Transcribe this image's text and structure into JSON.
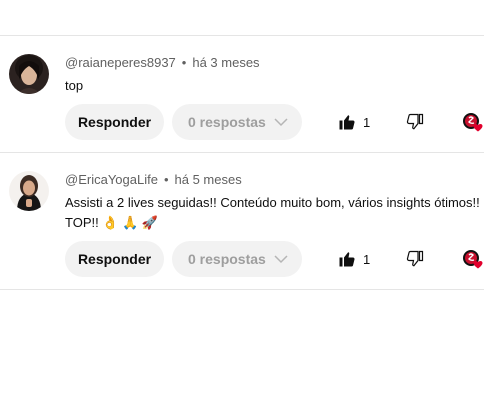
{
  "comments": [
    {
      "author": "@raianeperes8937",
      "separator": "•",
      "time": "há 3 meses",
      "text": "top",
      "reply_label": "Responder",
      "replies_label": "0 respostas",
      "likes": "1"
    },
    {
      "author": "@EricaYogaLife",
      "separator": "•",
      "time": "há 5 meses",
      "text": "Assisti a 2 lives seguidas!! Conteúdo muito bom, vários insights ótimos!! TOP!! 👌 🙏 🚀",
      "reply_label": "Responder",
      "replies_label": "0 respostas",
      "likes": "1"
    }
  ],
  "icons": {
    "like": "thumbs-up-icon",
    "dislike": "thumbs-down-icon",
    "replies_toggle": "chevron-down-icon",
    "creator_heart": "creator-heart-icon"
  },
  "colors": {
    "button_bg": "#f2f2f2",
    "heart_red": "#e1002d",
    "divider": "#e5e5e5",
    "meta_text": "#606060"
  }
}
